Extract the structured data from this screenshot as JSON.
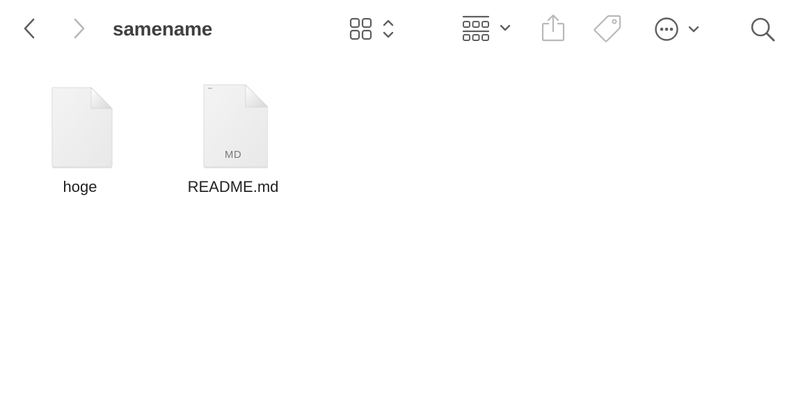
{
  "window": {
    "title": "samename"
  },
  "toolbar": {
    "back_icon": "chevron-left-icon",
    "forward_icon": "chevron-right-icon",
    "view_icon": "icon-grid-view-icon",
    "group_icon": "group-by-icon",
    "share_icon": "share-icon",
    "tag_icon": "tag-icon",
    "action_icon": "ellipsis-circle-icon",
    "search_icon": "search-icon"
  },
  "files": [
    {
      "name": "hoge",
      "badge": "",
      "icon": "generic-document-icon"
    },
    {
      "name": "README.md",
      "badge": "MD",
      "icon": "markdown-document-icon"
    }
  ],
  "colors": {
    "toolbar_icon": "#5f5f5f",
    "toolbar_icon_disabled": "#b8b8b8",
    "title": "#404040",
    "file_name": "#222222"
  }
}
